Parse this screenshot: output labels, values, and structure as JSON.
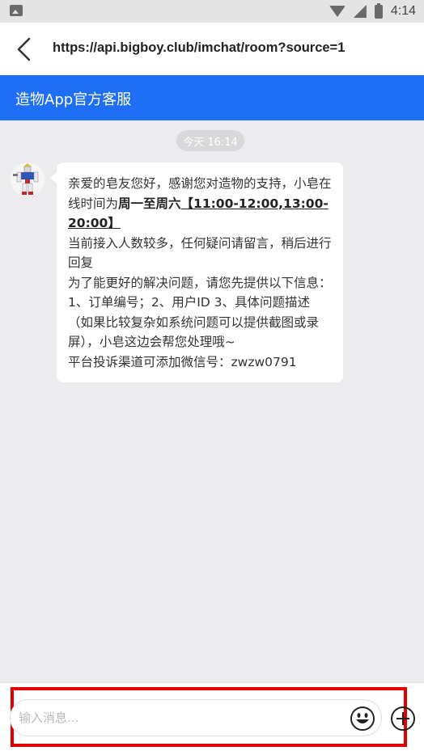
{
  "status_bar": {
    "time": "4:14",
    "icons": [
      "image-icon",
      "wifi-icon",
      "no-signal-icon",
      "battery-charging-icon"
    ]
  },
  "address_bar": {
    "back_icon": "chevron-left-icon",
    "url": "https://api.bigboy.club/imchat/room?source=1"
  },
  "header": {
    "title": "造物App官方客服",
    "color": "#1e6ff5"
  },
  "chat": {
    "timestamp": "今天 16:14",
    "message": {
      "line1_a": "亲爱的皂友您好，感谢您对造物的支持，小皂在线时间为",
      "line1_bold": "周一至周六",
      "line1_hours": "【11:00-12:00,13:00-20:00】",
      "line2": "当前接入人数较多，任何疑问请留言，稍后进行回复",
      "line3": "为了能更好的解决问题，请您先提供以下信息：1、订单编号；2、用户ID 3、具体问题描述（如果比较复杂如系统问题可以提供截图或录屏），小皂这边会帮您处理哦~",
      "line4": "平台投诉渠道可添加微信号：zwzw0791"
    }
  },
  "input_bar": {
    "placeholder": "输入消息...",
    "value": "",
    "emoji_icon": "emoji-icon",
    "plus_icon": "plus-circle-icon",
    "highlight_color": "#e00000"
  }
}
